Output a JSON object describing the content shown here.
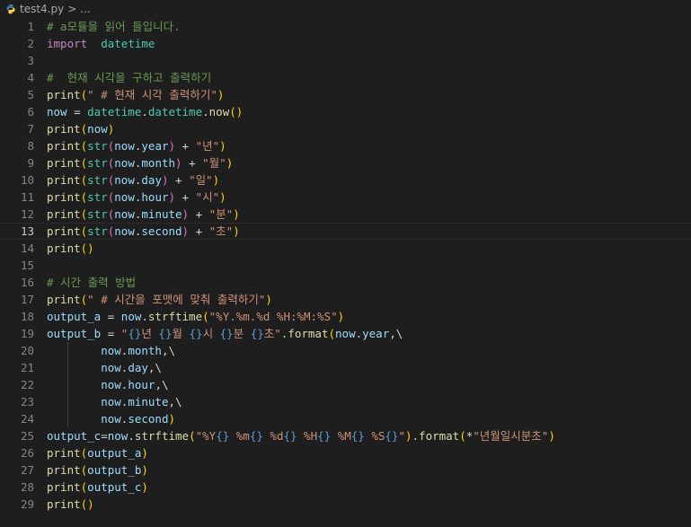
{
  "breadcrumb": {
    "file": "test4.py",
    "sep": ">",
    "more": "..."
  },
  "lines": [
    {
      "n": "1",
      "tokens": [
        [
          "kw-com",
          "# a모듈을 읽어 들입니다."
        ]
      ]
    },
    {
      "n": "2",
      "tokens": [
        [
          "kw-imp",
          "import"
        ],
        [
          "",
          "  "
        ],
        [
          "kw-mod",
          "datetime"
        ]
      ]
    },
    {
      "n": "3",
      "tokens": []
    },
    {
      "n": "4",
      "tokens": [
        [
          "kw-com",
          "#  현재 시각을 구하고 출력하기"
        ]
      ]
    },
    {
      "n": "5",
      "tokens": [
        [
          "kw-fn",
          "print"
        ],
        [
          "kw-b1",
          "("
        ],
        [
          "kw-str",
          "\" # 현재 시각 출력하기\""
        ],
        [
          "kw-b1",
          ")"
        ]
      ]
    },
    {
      "n": "6",
      "tokens": [
        [
          "kw-var",
          "now"
        ],
        [
          "",
          " = "
        ],
        [
          "kw-mod",
          "datetime"
        ],
        [
          "",
          "."
        ],
        [
          "kw-mod",
          "datetime"
        ],
        [
          "",
          "."
        ],
        [
          "kw-fn",
          "now"
        ],
        [
          "kw-b1",
          "()"
        ]
      ]
    },
    {
      "n": "7",
      "tokens": [
        [
          "kw-fn",
          "print"
        ],
        [
          "kw-b1",
          "("
        ],
        [
          "kw-var",
          "now"
        ],
        [
          "kw-b1",
          ")"
        ]
      ]
    },
    {
      "n": "8",
      "tokens": [
        [
          "kw-fn",
          "print"
        ],
        [
          "kw-b1",
          "("
        ],
        [
          "kw-mod",
          "str"
        ],
        [
          "kw-b2",
          "("
        ],
        [
          "kw-var",
          "now"
        ],
        [
          "",
          "."
        ],
        [
          "kw-var",
          "year"
        ],
        [
          "kw-b2",
          ")"
        ],
        [
          "",
          " + "
        ],
        [
          "kw-str",
          "\"년\""
        ],
        [
          "kw-b1",
          ")"
        ]
      ]
    },
    {
      "n": "9",
      "tokens": [
        [
          "kw-fn",
          "print"
        ],
        [
          "kw-b1",
          "("
        ],
        [
          "kw-mod",
          "str"
        ],
        [
          "kw-b2",
          "("
        ],
        [
          "kw-var",
          "now"
        ],
        [
          "",
          "."
        ],
        [
          "kw-var",
          "month"
        ],
        [
          "kw-b2",
          ")"
        ],
        [
          "",
          " + "
        ],
        [
          "kw-str",
          "\"월\""
        ],
        [
          "kw-b1",
          ")"
        ]
      ]
    },
    {
      "n": "10",
      "tokens": [
        [
          "kw-fn",
          "print"
        ],
        [
          "kw-b1",
          "("
        ],
        [
          "kw-mod",
          "str"
        ],
        [
          "kw-b2",
          "("
        ],
        [
          "kw-var",
          "now"
        ],
        [
          "",
          "."
        ],
        [
          "kw-var",
          "day"
        ],
        [
          "kw-b2",
          ")"
        ],
        [
          "",
          " + "
        ],
        [
          "kw-str",
          "\"일\""
        ],
        [
          "kw-b1",
          ")"
        ]
      ]
    },
    {
      "n": "11",
      "tokens": [
        [
          "kw-fn",
          "print"
        ],
        [
          "kw-b1",
          "("
        ],
        [
          "kw-mod",
          "str"
        ],
        [
          "kw-b2",
          "("
        ],
        [
          "kw-var",
          "now"
        ],
        [
          "",
          "."
        ],
        [
          "kw-var",
          "hour"
        ],
        [
          "kw-b2",
          ")"
        ],
        [
          "",
          " + "
        ],
        [
          "kw-str",
          "\"시\""
        ],
        [
          "kw-b1",
          ")"
        ]
      ]
    },
    {
      "n": "12",
      "tokens": [
        [
          "kw-fn",
          "print"
        ],
        [
          "kw-b1",
          "("
        ],
        [
          "kw-mod",
          "str"
        ],
        [
          "kw-b2",
          "("
        ],
        [
          "kw-var",
          "now"
        ],
        [
          "",
          "."
        ],
        [
          "kw-var",
          "minute"
        ],
        [
          "kw-b2",
          ")"
        ],
        [
          "",
          " + "
        ],
        [
          "kw-str",
          "\"분\""
        ],
        [
          "kw-b1",
          ")"
        ]
      ]
    },
    {
      "n": "13",
      "current": true,
      "tokens": [
        [
          "kw-fn",
          "print"
        ],
        [
          "kw-b1",
          "("
        ],
        [
          "kw-mod",
          "str"
        ],
        [
          "kw-b2",
          "("
        ],
        [
          "kw-var",
          "now"
        ],
        [
          "",
          "."
        ],
        [
          "kw-var",
          "second"
        ],
        [
          "kw-b2",
          ")"
        ],
        [
          "",
          " + "
        ],
        [
          "kw-str",
          "\"초\""
        ],
        [
          "kw-b1",
          ")"
        ]
      ]
    },
    {
      "n": "14",
      "tokens": [
        [
          "kw-fn",
          "print"
        ],
        [
          "kw-b1",
          "()"
        ]
      ]
    },
    {
      "n": "15",
      "tokens": []
    },
    {
      "n": "16",
      "tokens": [
        [
          "kw-com",
          "# 시간 출력 방법"
        ]
      ]
    },
    {
      "n": "17",
      "tokens": [
        [
          "kw-fn",
          "print"
        ],
        [
          "kw-b1",
          "("
        ],
        [
          "kw-str",
          "\" # 시간을 포맷에 맞춰 출력하기\""
        ],
        [
          "kw-b1",
          ")"
        ]
      ]
    },
    {
      "n": "18",
      "tokens": [
        [
          "kw-var",
          "output_a"
        ],
        [
          "",
          " = "
        ],
        [
          "kw-var",
          "now"
        ],
        [
          "",
          "."
        ],
        [
          "kw-fn",
          "strftime"
        ],
        [
          "kw-b1",
          "("
        ],
        [
          "kw-str",
          "\"%Y.%m.%d %H:%M:%S\""
        ],
        [
          "kw-b1",
          ")"
        ]
      ]
    },
    {
      "n": "19",
      "tokens": [
        [
          "kw-var",
          "output_b"
        ],
        [
          "",
          " = "
        ],
        [
          "kw-str",
          "\""
        ],
        [
          "kw-str-fmt",
          "{}"
        ],
        [
          "kw-str",
          "년 "
        ],
        [
          "kw-str-fmt",
          "{}"
        ],
        [
          "kw-str",
          "월 "
        ],
        [
          "kw-str-fmt",
          "{}"
        ],
        [
          "kw-str",
          "시 "
        ],
        [
          "kw-str-fmt",
          "{}"
        ],
        [
          "kw-str",
          "분 "
        ],
        [
          "kw-str-fmt",
          "{}"
        ],
        [
          "kw-str",
          "초\""
        ],
        [
          "",
          "."
        ],
        [
          "kw-fn",
          "format"
        ],
        [
          "kw-b1",
          "("
        ],
        [
          "kw-var",
          "now"
        ],
        [
          "",
          "."
        ],
        [
          "kw-var",
          "year"
        ],
        [
          "",
          ",\\"
        ]
      ]
    },
    {
      "n": "20",
      "indent": true,
      "tokens": [
        [
          "",
          "        "
        ],
        [
          "kw-var",
          "now"
        ],
        [
          "",
          "."
        ],
        [
          "kw-var",
          "month"
        ],
        [
          "",
          ",\\"
        ]
      ]
    },
    {
      "n": "21",
      "indent": true,
      "tokens": [
        [
          "",
          "        "
        ],
        [
          "kw-var",
          "now"
        ],
        [
          "",
          "."
        ],
        [
          "kw-var",
          "day"
        ],
        [
          "",
          ",\\"
        ]
      ]
    },
    {
      "n": "22",
      "indent": true,
      "tokens": [
        [
          "",
          "        "
        ],
        [
          "kw-var",
          "now"
        ],
        [
          "",
          "."
        ],
        [
          "kw-var",
          "hour"
        ],
        [
          "",
          ",\\"
        ]
      ]
    },
    {
      "n": "23",
      "indent": true,
      "tokens": [
        [
          "",
          "        "
        ],
        [
          "kw-var",
          "now"
        ],
        [
          "",
          "."
        ],
        [
          "kw-var",
          "minute"
        ],
        [
          "",
          ",\\"
        ]
      ]
    },
    {
      "n": "24",
      "indent": true,
      "tokens": [
        [
          "",
          "        "
        ],
        [
          "kw-var",
          "now"
        ],
        [
          "",
          "."
        ],
        [
          "kw-var",
          "second"
        ],
        [
          "kw-b1",
          ")"
        ]
      ]
    },
    {
      "n": "25",
      "tokens": [
        [
          "kw-var",
          "output_c"
        ],
        [
          "",
          "="
        ],
        [
          "kw-var",
          "now"
        ],
        [
          "",
          "."
        ],
        [
          "kw-fn",
          "strftime"
        ],
        [
          "kw-b1",
          "("
        ],
        [
          "kw-str",
          "\"%Y"
        ],
        [
          "kw-str-fmt",
          "{}"
        ],
        [
          "kw-str",
          " %m"
        ],
        [
          "kw-str-fmt",
          "{}"
        ],
        [
          "kw-str",
          " %d"
        ],
        [
          "kw-str-fmt",
          "{}"
        ],
        [
          "kw-str",
          " %H"
        ],
        [
          "kw-str-fmt",
          "{}"
        ],
        [
          "kw-str",
          " %M"
        ],
        [
          "kw-str-fmt",
          "{}"
        ],
        [
          "kw-str",
          " %S"
        ],
        [
          "kw-str-fmt",
          "{}"
        ],
        [
          "kw-str",
          "\""
        ],
        [
          "kw-b1",
          ")"
        ],
        [
          "",
          "."
        ],
        [
          "kw-fn",
          "format"
        ],
        [
          "kw-b1",
          "("
        ],
        [
          "",
          "*"
        ],
        [
          "kw-str",
          "\"년월일시분초\""
        ],
        [
          "kw-b1",
          ")"
        ]
      ]
    },
    {
      "n": "26",
      "tokens": [
        [
          "kw-fn",
          "print"
        ],
        [
          "kw-b1",
          "("
        ],
        [
          "kw-var",
          "output_a"
        ],
        [
          "kw-b1",
          ")"
        ]
      ]
    },
    {
      "n": "27",
      "tokens": [
        [
          "kw-fn",
          "print"
        ],
        [
          "kw-b1",
          "("
        ],
        [
          "kw-var",
          "output_b"
        ],
        [
          "kw-b1",
          ")"
        ]
      ]
    },
    {
      "n": "28",
      "tokens": [
        [
          "kw-fn",
          "print"
        ],
        [
          "kw-b1",
          "("
        ],
        [
          "kw-var",
          "output_c"
        ],
        [
          "kw-b1",
          ")"
        ]
      ]
    },
    {
      "n": "29",
      "tokens": [
        [
          "kw-fn",
          "print"
        ],
        [
          "kw-b1",
          "()"
        ]
      ]
    }
  ]
}
